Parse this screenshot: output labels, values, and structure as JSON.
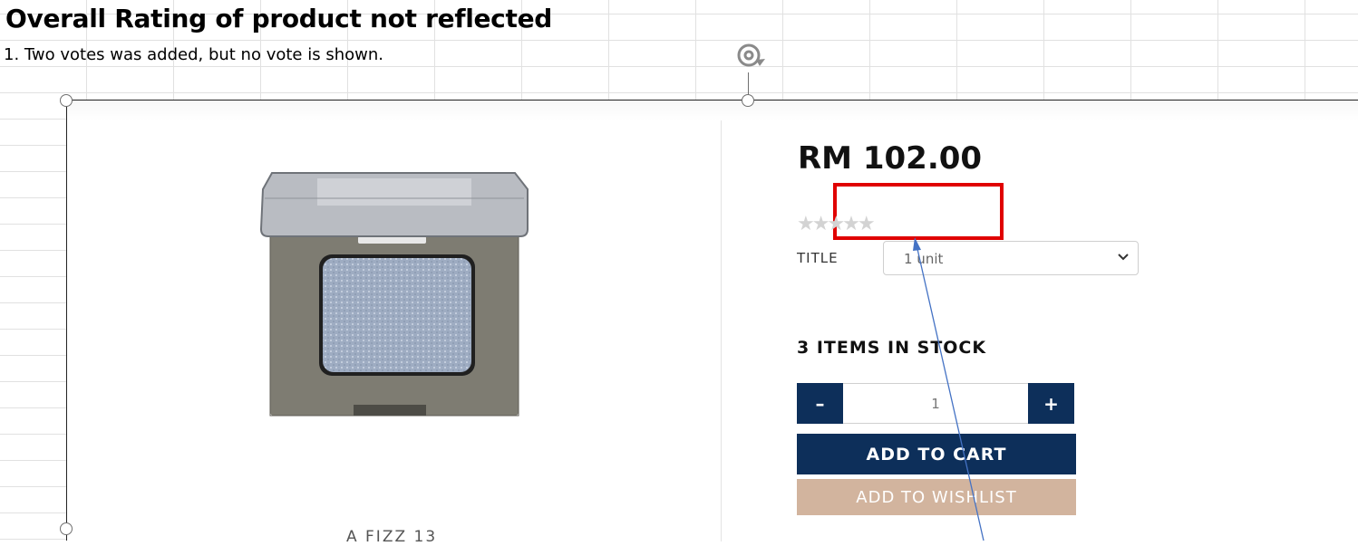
{
  "annotation": {
    "title": "Overall Rating of product not reflected",
    "note": "1. Two votes was added, but no vote is shown."
  },
  "product": {
    "price": "RM 102.00",
    "rating_stars": "★★★★★",
    "rating_value": 0,
    "title_label": "TITLE",
    "variant_selected": "1 unit",
    "stock_text": "3 ITEMS IN STOCK",
    "quantity": "1",
    "qty_minus": "–",
    "qty_plus": "+",
    "add_to_cart_label": "ADD TO CART",
    "add_to_wishlist_label": "ADD TO WISHLIST",
    "name": "A FIZZ 13"
  },
  "colors": {
    "highlight": "#e00000",
    "primary_button": "#0d2f5a",
    "wishlist_button": "#d2b49e",
    "arrow": "#4472c4"
  },
  "icons": [
    "rotate-icon",
    "chevron-down-icon",
    "minus-icon",
    "plus-icon",
    "star-icon"
  ]
}
